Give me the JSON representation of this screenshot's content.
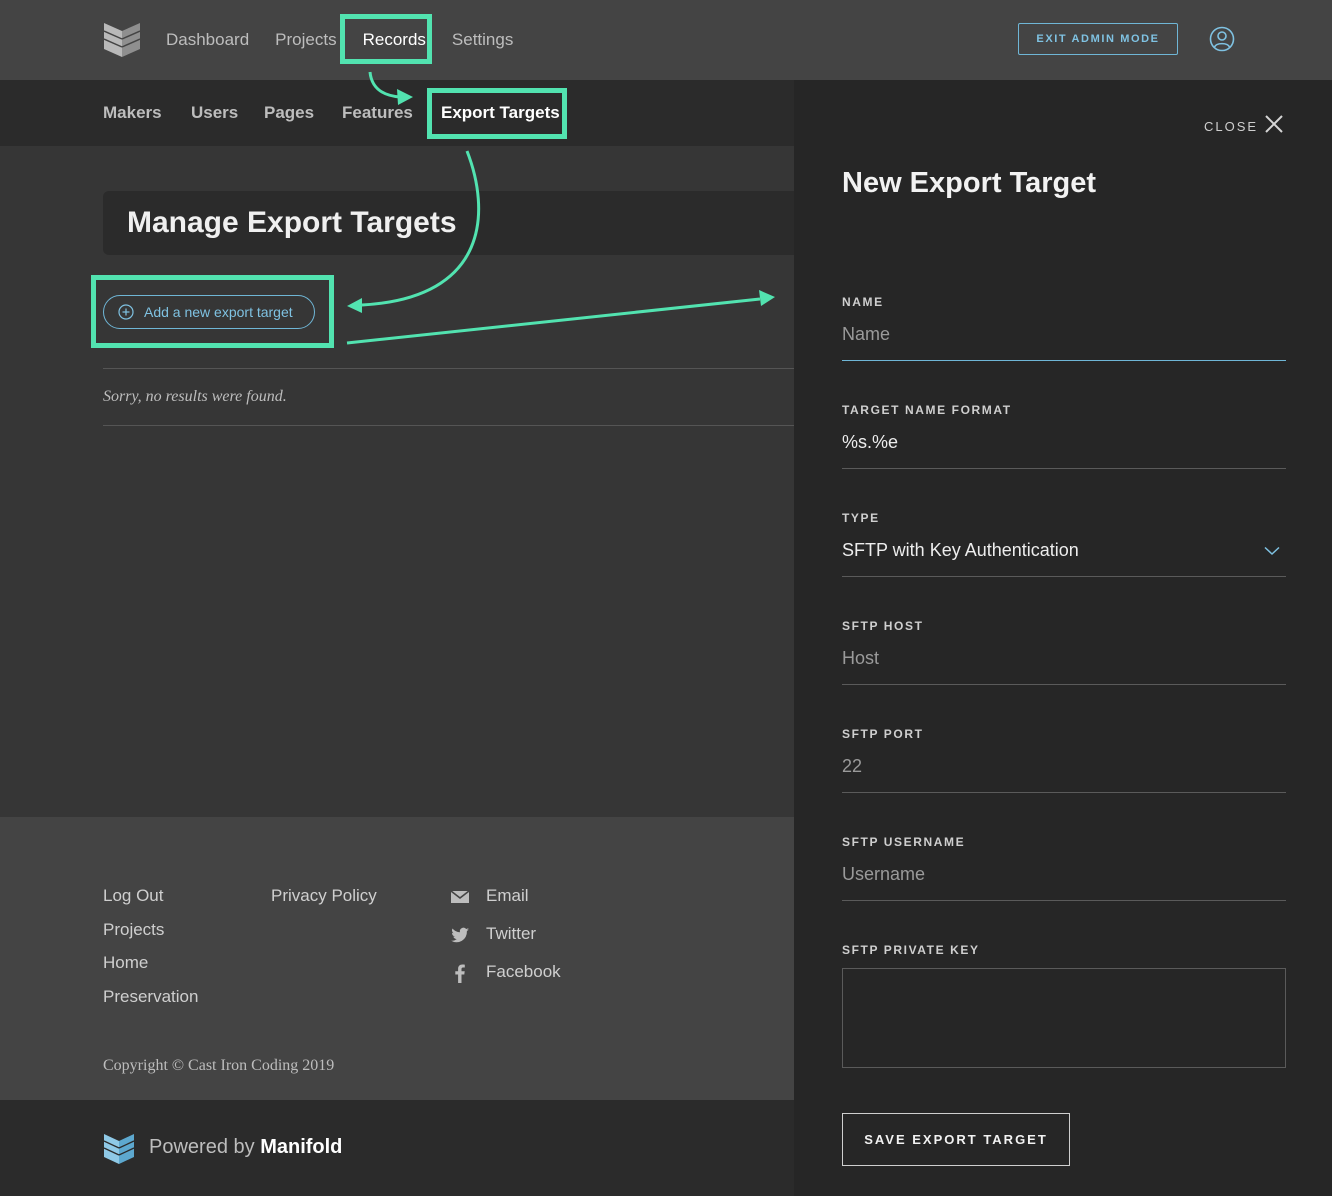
{
  "header": {
    "nav": [
      "Dashboard",
      "Projects",
      "Records",
      "Settings"
    ],
    "active_nav": "Records",
    "exit_button": "EXIT ADMIN MODE"
  },
  "subnav": {
    "items": [
      "Makers",
      "Users",
      "Pages",
      "Features",
      "Export Targets"
    ],
    "active": "Export Targets"
  },
  "main": {
    "title": "Manage Export Targets",
    "add_button": "Add a new export target",
    "empty_message": "Sorry, no results were found."
  },
  "footer": {
    "col1": [
      "Log Out",
      "Projects",
      "Home",
      "Preservation"
    ],
    "col2": [
      "Privacy Policy"
    ],
    "social": [
      {
        "label": "Email",
        "icon": "mail-icon"
      },
      {
        "label": "Twitter",
        "icon": "twitter-icon"
      },
      {
        "label": "Facebook",
        "icon": "facebook-icon"
      }
    ],
    "copyright": "Copyright © Cast Iron Coding 2019",
    "powered_prefix": "Powered by",
    "powered_brand": "Manifold"
  },
  "drawer": {
    "close_label": "CLOSE",
    "title": "New Export Target",
    "fields": {
      "name": {
        "label": "NAME",
        "placeholder": "Name",
        "value": ""
      },
      "target_name_format": {
        "label": "TARGET NAME FORMAT",
        "value": "%s.%e"
      },
      "type": {
        "label": "TYPE",
        "value": "SFTP with Key Authentication"
      },
      "sftp_host": {
        "label": "SFTP HOST",
        "placeholder": "Host",
        "value": ""
      },
      "sftp_port": {
        "label": "SFTP PORT",
        "placeholder": "22",
        "value": ""
      },
      "sftp_username": {
        "label": "SFTP USERNAME",
        "placeholder": "Username",
        "value": ""
      },
      "sftp_private_key": {
        "label": "SFTP PRIVATE KEY",
        "value": ""
      }
    },
    "save_button": "SAVE EXPORT TARGET"
  },
  "colors": {
    "accent": "#6fb6d6",
    "annotation": "#52e3b0",
    "header_bg": "#444444",
    "drawer_bg": "#262626"
  }
}
